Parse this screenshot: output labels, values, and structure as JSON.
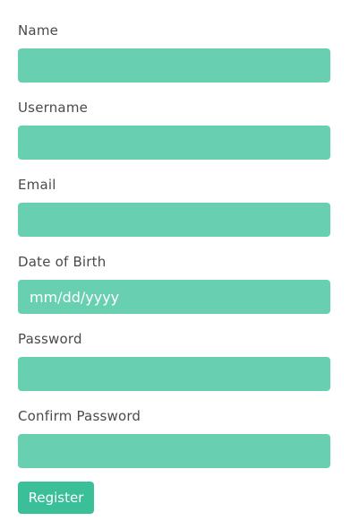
{
  "form": {
    "fields": [
      {
        "label": "Name",
        "value": "",
        "placeholder": ""
      },
      {
        "label": "Username",
        "value": "",
        "placeholder": ""
      },
      {
        "label": "Email",
        "value": "",
        "placeholder": ""
      },
      {
        "label": "Date of Birth",
        "value": "",
        "placeholder": "mm/dd/yyyy"
      },
      {
        "label": "Password",
        "value": "",
        "placeholder": ""
      },
      {
        "label": "Confirm Password",
        "value": "",
        "placeholder": ""
      }
    ],
    "submit_label": "Register"
  },
  "colors": {
    "input_background": "#68cfb1",
    "button_background": "#3bbf98",
    "label_text": "#4a4a4a"
  }
}
